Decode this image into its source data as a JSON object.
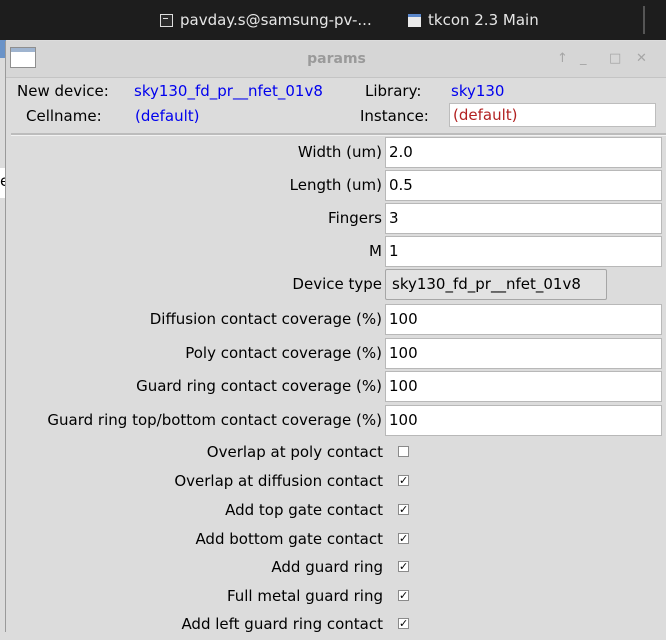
{
  "taskbar": {
    "terminal_label": "pavday.s@samsung-pv-...",
    "tkcon_label": "tkcon 2.3 Main"
  },
  "background_window": {
    "partial_text": "e"
  },
  "window": {
    "title": "params",
    "controls": {
      "up": "↑",
      "minimize": "_",
      "maximize": "□",
      "close": "✕"
    }
  },
  "header": {
    "new_device_label": "New device:",
    "new_device_value": "sky130_fd_pr__nfet_01v8",
    "library_label": "Library:",
    "library_value": "sky130",
    "cellname_label": "Cellname:",
    "cellname_value": "(default)",
    "instance_label": "Instance:",
    "instance_value": "(default)"
  },
  "params": {
    "width": {
      "label": "Width (um)",
      "value": "2.0"
    },
    "length": {
      "label": "Length (um)",
      "value": "0.5"
    },
    "fingers": {
      "label": "Fingers",
      "value": "3"
    },
    "m": {
      "label": "M",
      "value": "1"
    },
    "device_type": {
      "label": "Device type",
      "value": "sky130_fd_pr__nfet_01v8"
    },
    "diff_cov": {
      "label": "Diffusion contact coverage (%)",
      "value": "100"
    },
    "poly_cov": {
      "label": "Poly contact coverage (%)",
      "value": "100"
    },
    "guard_cov": {
      "label": "Guard ring contact coverage (%)",
      "value": "100"
    },
    "guard_tb_cov": {
      "label": "Guard ring top/bottom contact coverage (%)",
      "value": "100"
    }
  },
  "checkboxes": {
    "overlap_poly": {
      "label": "Overlap at poly contact",
      "mark": ""
    },
    "overlap_diff": {
      "label": "Overlap at diffusion contact",
      "mark": "✓"
    },
    "top_gate": {
      "label": "Add top gate contact",
      "mark": "✓"
    },
    "bottom_gate": {
      "label": "Add bottom gate contact",
      "mark": "✓"
    },
    "guard_ring": {
      "label": "Add guard ring",
      "mark": "✓"
    },
    "full_metal": {
      "label": "Full metal guard ring",
      "mark": "✓"
    },
    "left_guard": {
      "label": "Add left guard ring contact",
      "mark": "✓"
    }
  },
  "colors": {
    "link_blue": "#0000ee",
    "instance_red": "#b22222",
    "taskbar_bg": "#1d1d1d",
    "window_bg": "#dcdcdc"
  }
}
